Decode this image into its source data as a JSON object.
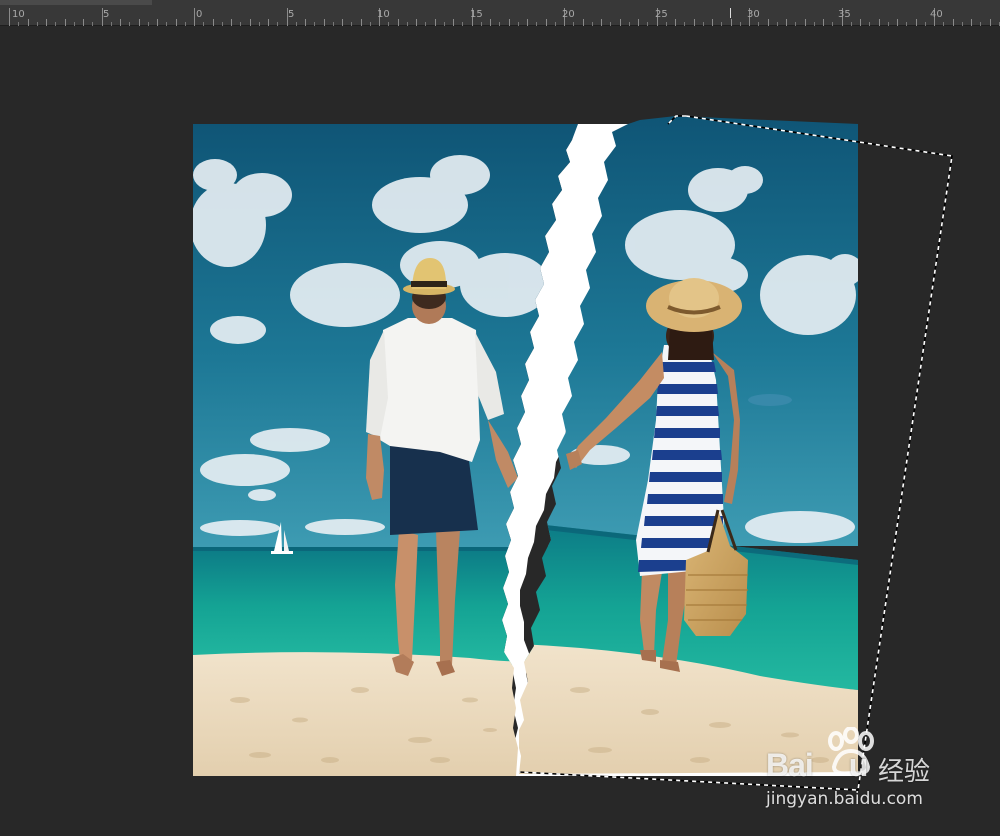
{
  "ruler": {
    "ticks": [
      {
        "label": "10"
      },
      {
        "label": "5"
      },
      {
        "label": "0"
      },
      {
        "label": "5"
      },
      {
        "label": "10"
      },
      {
        "label": "15"
      },
      {
        "label": "20"
      },
      {
        "label": "25"
      },
      {
        "label": "30"
      },
      {
        "label": "35"
      },
      {
        "label": "40"
      }
    ]
  },
  "canvas": {
    "image_description_icon": "torn-photo-beach-couple",
    "selection_style": "marching-ants"
  },
  "watermark": {
    "logo_text": "Bai",
    "logo_text_end": "u",
    "sub_text": "经验",
    "url": "jingyan.baidu.com"
  },
  "colors": {
    "workspace": "#282828",
    "ruler": "#383838",
    "sky": "#1a6f8f",
    "sea": "#16a596",
    "sand": "#ecdcc4"
  }
}
